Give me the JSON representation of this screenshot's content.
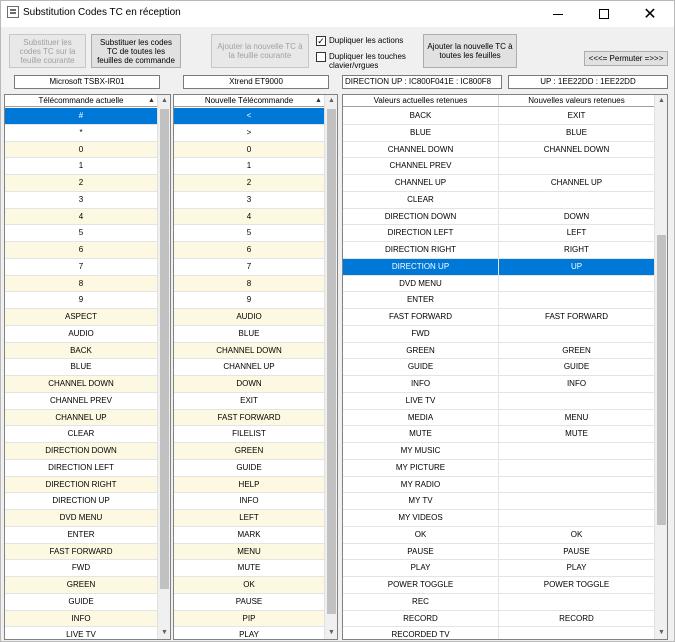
{
  "window": {
    "title": "Substitution Codes TC en réception",
    "minimize_icon": "minimize-icon",
    "maximize_icon": "maximize-icon",
    "close_icon": "close-icon",
    "close_glyph": "✕"
  },
  "toolbar": {
    "substitute_current_label": "Substituer les codes TC sur la feuille courante",
    "substitute_all_label": "Substituer les codes TC de toutes les feuilles de commande",
    "add_remote_current_label": "Ajouter la nouvelle TC à la feuille courante",
    "duplicate_actions_label": "Dupliquer les actions",
    "duplicate_actions_checked": true,
    "duplicate_keys_label": "Dupliquer les touches clavier/vrgues",
    "duplicate_keys_checked": false,
    "add_remote_all_label": "Ajouter la nouvelle TC à toutes les feuilles",
    "swap_label": "<<<= Permuter =>>>"
  },
  "fields": {
    "current_remote": "Microsoft TSBX-IR01",
    "new_remote": "Xtrend ET9000",
    "current_codes": "DIRECTION UP : IC800F041E : IC800F8",
    "new_codes": "UP : 1EE22DD : 1EE22DD"
  },
  "left_grid": {
    "header": "Télécommande actuelle",
    "rows": [
      "#",
      "*",
      "0",
      "1",
      "2",
      "3",
      "4",
      "5",
      "6",
      "7",
      "8",
      "9",
      "ASPECT",
      "AUDIO",
      "BACK",
      "BLUE",
      "CHANNEL DOWN",
      "CHANNEL PREV",
      "CHANNEL UP",
      "CLEAR",
      "DIRECTION DOWN",
      "DIRECTION LEFT",
      "DIRECTION RIGHT",
      "DIRECTION UP",
      "DVD MENU",
      "ENTER",
      "FAST FORWARD",
      "FWD",
      "GREEN",
      "GUIDE",
      "INFO",
      "LIVE TV"
    ]
  },
  "middle_grid": {
    "header": "Nouvelle Télécommande",
    "rows": [
      "<",
      ">",
      "0",
      "1",
      "2",
      "3",
      "4",
      "5",
      "6",
      "7",
      "8",
      "9",
      "AUDIO",
      "BLUE",
      "CHANNEL DOWN",
      "CHANNEL UP",
      "DOWN",
      "EXIT",
      "FAST FORWARD",
      "FILELIST",
      "GREEN",
      "GUIDE",
      "HELP",
      "INFO",
      "LEFT",
      "MARK",
      "MENU",
      "MUTE",
      "OK",
      "PAUSE",
      "PIP",
      "PLAY"
    ]
  },
  "right_grid": {
    "header_current": "Valeurs actuelles retenues",
    "header_new": "Nouvelles valeurs retenues",
    "rows": [
      [
        "BACK",
        "EXIT"
      ],
      [
        "BLUE",
        "BLUE"
      ],
      [
        "CHANNEL DOWN",
        "CHANNEL DOWN"
      ],
      [
        "CHANNEL PREV",
        ""
      ],
      [
        "CHANNEL UP",
        "CHANNEL UP"
      ],
      [
        "CLEAR",
        ""
      ],
      [
        "DIRECTION DOWN",
        "DOWN"
      ],
      [
        "DIRECTION LEFT",
        "LEFT"
      ],
      [
        "DIRECTION RIGHT",
        "RIGHT"
      ],
      [
        "DIRECTION UP",
        "UP"
      ],
      [
        "DVD MENU",
        ""
      ],
      [
        "ENTER",
        ""
      ],
      [
        "FAST FORWARD",
        "FAST FORWARD"
      ],
      [
        "FWD",
        ""
      ],
      [
        "GREEN",
        "GREEN"
      ],
      [
        "GUIDE",
        "GUIDE"
      ],
      [
        "INFO",
        "INFO"
      ],
      [
        "LIVE TV",
        ""
      ],
      [
        "MEDIA",
        "MENU"
      ],
      [
        "MUTE",
        "MUTE"
      ],
      [
        "MY MUSIC",
        ""
      ],
      [
        "MY PICTURE",
        ""
      ],
      [
        "MY RADIO",
        ""
      ],
      [
        "MY TV",
        ""
      ],
      [
        "MY VIDEOS",
        ""
      ],
      [
        "OK",
        "OK"
      ],
      [
        "PAUSE",
        "PAUSE"
      ],
      [
        "PLAY",
        "PLAY"
      ],
      [
        "POWER TOGGLE",
        "POWER TOGGLE"
      ],
      [
        "REC",
        ""
      ],
      [
        "RECORD",
        "RECORD"
      ],
      [
        "RECORDED TV",
        ""
      ]
    ]
  },
  "colors": {
    "selection": "#0078d7",
    "alt_row": "#fdf8e1"
  },
  "selection": {
    "left_row": 0,
    "middle_row": 0,
    "right_row": 9
  }
}
